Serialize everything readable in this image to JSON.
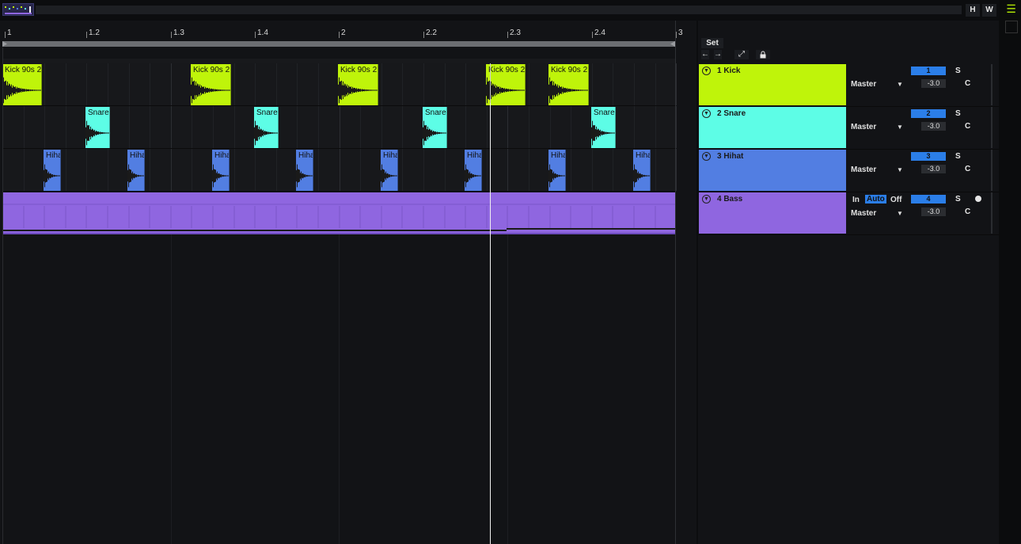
{
  "colors": {
    "kick": "#bff40a",
    "snare": "#5dfde6",
    "hihat": "#527ee2",
    "bass": "#8f66e0",
    "accent": "#2b7ee8"
  },
  "topbar": {
    "h_label": "H",
    "w_label": "W",
    "menu_icon": "hamburger-icon"
  },
  "ruler": {
    "markers": [
      "1",
      "1.2",
      "1.3",
      "1.4",
      "2",
      "2.2",
      "2.3",
      "2.4",
      "3"
    ]
  },
  "set": {
    "label": "Set",
    "back_icon": "arrow-left-icon",
    "forward_icon": "arrow-right-icon",
    "expand_icon": "expand-icon",
    "lock_icon": "lock-icon"
  },
  "tracks": [
    {
      "name": "1 Kick",
      "number": "1",
      "output": "Master",
      "volume": "-3.0",
      "solo": "S",
      "pan": "C",
      "clip_label": "Kick 90s 2"
    },
    {
      "name": "2 Snare",
      "number": "2",
      "output": "Master",
      "volume": "-3.0",
      "solo": "S",
      "pan": "C",
      "clip_label": "Snare"
    },
    {
      "name": "3 Hihat",
      "number": "3",
      "output": "Master",
      "volume": "-3.0",
      "solo": "S",
      "pan": "C",
      "clip_label": "Hihat"
    },
    {
      "name": "4 Bass",
      "number": "4",
      "output": "Master",
      "volume": "-3.0",
      "solo": "S",
      "pan": "C",
      "monitor": {
        "in": "In",
        "auto": "Auto",
        "off": "Off"
      }
    }
  ]
}
